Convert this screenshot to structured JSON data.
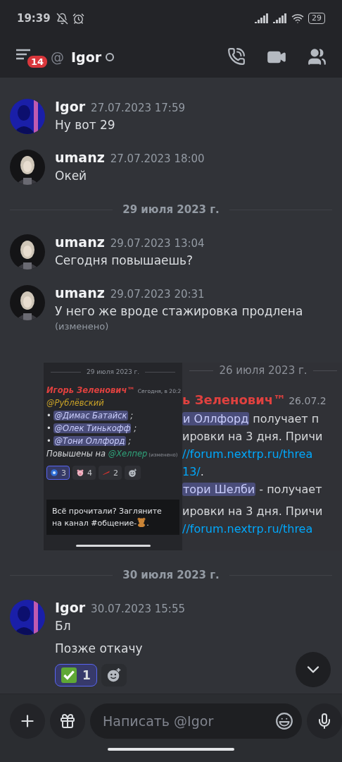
{
  "status_bar": {
    "time": "19:39",
    "battery": "29"
  },
  "header": {
    "unread_badge": "14",
    "prefix": "@",
    "title": "Igor",
    "online": false
  },
  "feed": [
    {
      "kind": "message",
      "author": "Igor",
      "timestamp": "27.07.2023 17:59",
      "lines": [
        "Ну вот 29"
      ]
    },
    {
      "kind": "message",
      "author": "umanz",
      "timestamp": "27.07.2023 18:00",
      "lines": [
        "Окей"
      ]
    },
    {
      "kind": "divider",
      "label": "29 июля 2023 г."
    },
    {
      "kind": "message",
      "author": "umanz",
      "timestamp": "29.07.2023 13:04",
      "lines": [
        "Сегодня повышаешь?"
      ]
    },
    {
      "kind": "message",
      "author": "umanz",
      "timestamp": "29.07.2023 20:31",
      "lines": [
        "У него же вроде стажировка продлена"
      ],
      "edited": "(изменено)",
      "attachments": [
        {
          "kind": "compact",
          "date_divider": "29 июля 2023 г.",
          "author": "Игорь Зеленович™",
          "timestamp": "Сегодня, в 20:2",
          "lines": [
            [
              {
                "kind": "role_mention",
                "text": "@Рублёвский",
                "color": "#c9a227"
              }
            ],
            [
              {
                "kind": "plain",
                "text": "• "
              },
              {
                "kind": "user_mention",
                "text": "@Димас Батайск"
              },
              {
                "kind": "plain",
                "text": " ;"
              }
            ],
            [
              {
                "kind": "plain",
                "text": "• "
              },
              {
                "kind": "user_mention",
                "text": "@Олек Тинькофф"
              },
              {
                "kind": "plain",
                "text": " ;"
              }
            ],
            [
              {
                "kind": "plain",
                "text": "• "
              },
              {
                "kind": "user_mention",
                "text": "@Тони Оллфорд"
              },
              {
                "kind": "plain",
                "text": " ;"
              }
            ],
            [
              {
                "kind": "plain",
                "text": "Повышены на "
              },
              {
                "kind": "role_mention",
                "text": "@Хелпер",
                "color": "#2fa37a"
              },
              {
                "kind": "edited",
                "text": "(изменено)"
              }
            ]
          ],
          "reactions": [
            {
              "kind": "orb",
              "count": "3",
              "selected": true
            },
            {
              "kind": "pig",
              "count": "4",
              "selected": false
            },
            {
              "kind": "streak",
              "count": "2",
              "selected": false
            }
          ],
          "card": [
            {
              "kind": "plain",
              "text": "Всё прочитали? Загляните на канал #общение-"
            },
            {
              "kind": "bear"
            },
            {
              "kind": "plain",
              "text": "."
            }
          ]
        },
        {
          "kind": "zoomed",
          "date_divider": "26 июля 2023 г.",
          "author": "ь Зеленович™",
          "timestamp": "26.07.2",
          "lines": [
            [
              {
                "kind": "user_mention",
                "text": "и Оллфорд"
              },
              {
                "kind": "plain",
                "text": " получает п"
              }
            ],
            [
              {
                "kind": "plain",
                "text": "ировки на 3 дня. Причи"
              }
            ],
            [
              {
                "kind": "link",
                "text": "//forum.nextrp.ru/threa"
              }
            ],
            [
              {
                "kind": "link",
                "text": "13/"
              },
              {
                "kind": "plain",
                "text": "."
              }
            ],
            [
              {
                "kind": "user_mention",
                "text": "тори Шелби"
              },
              {
                "kind": "plain",
                "text": " - получает"
              }
            ],
            [
              {
                "kind": "plain",
                "text": "ировки на 3 дня. Причи"
              }
            ],
            [
              {
                "kind": "link",
                "text": "//forum.nextrp.ru/threa"
              }
            ]
          ]
        }
      ]
    },
    {
      "kind": "divider",
      "label": "30 июля 2023 г."
    },
    {
      "kind": "message",
      "author": "Igor",
      "timestamp": "30.07.2023 15:55",
      "lines": [
        "Бл",
        "Позже откачу"
      ],
      "reactions": [
        {
          "kind": "check",
          "count": "1",
          "selected": true
        }
      ]
    }
  ],
  "composer": {
    "placeholder": "Написать @Igor"
  }
}
